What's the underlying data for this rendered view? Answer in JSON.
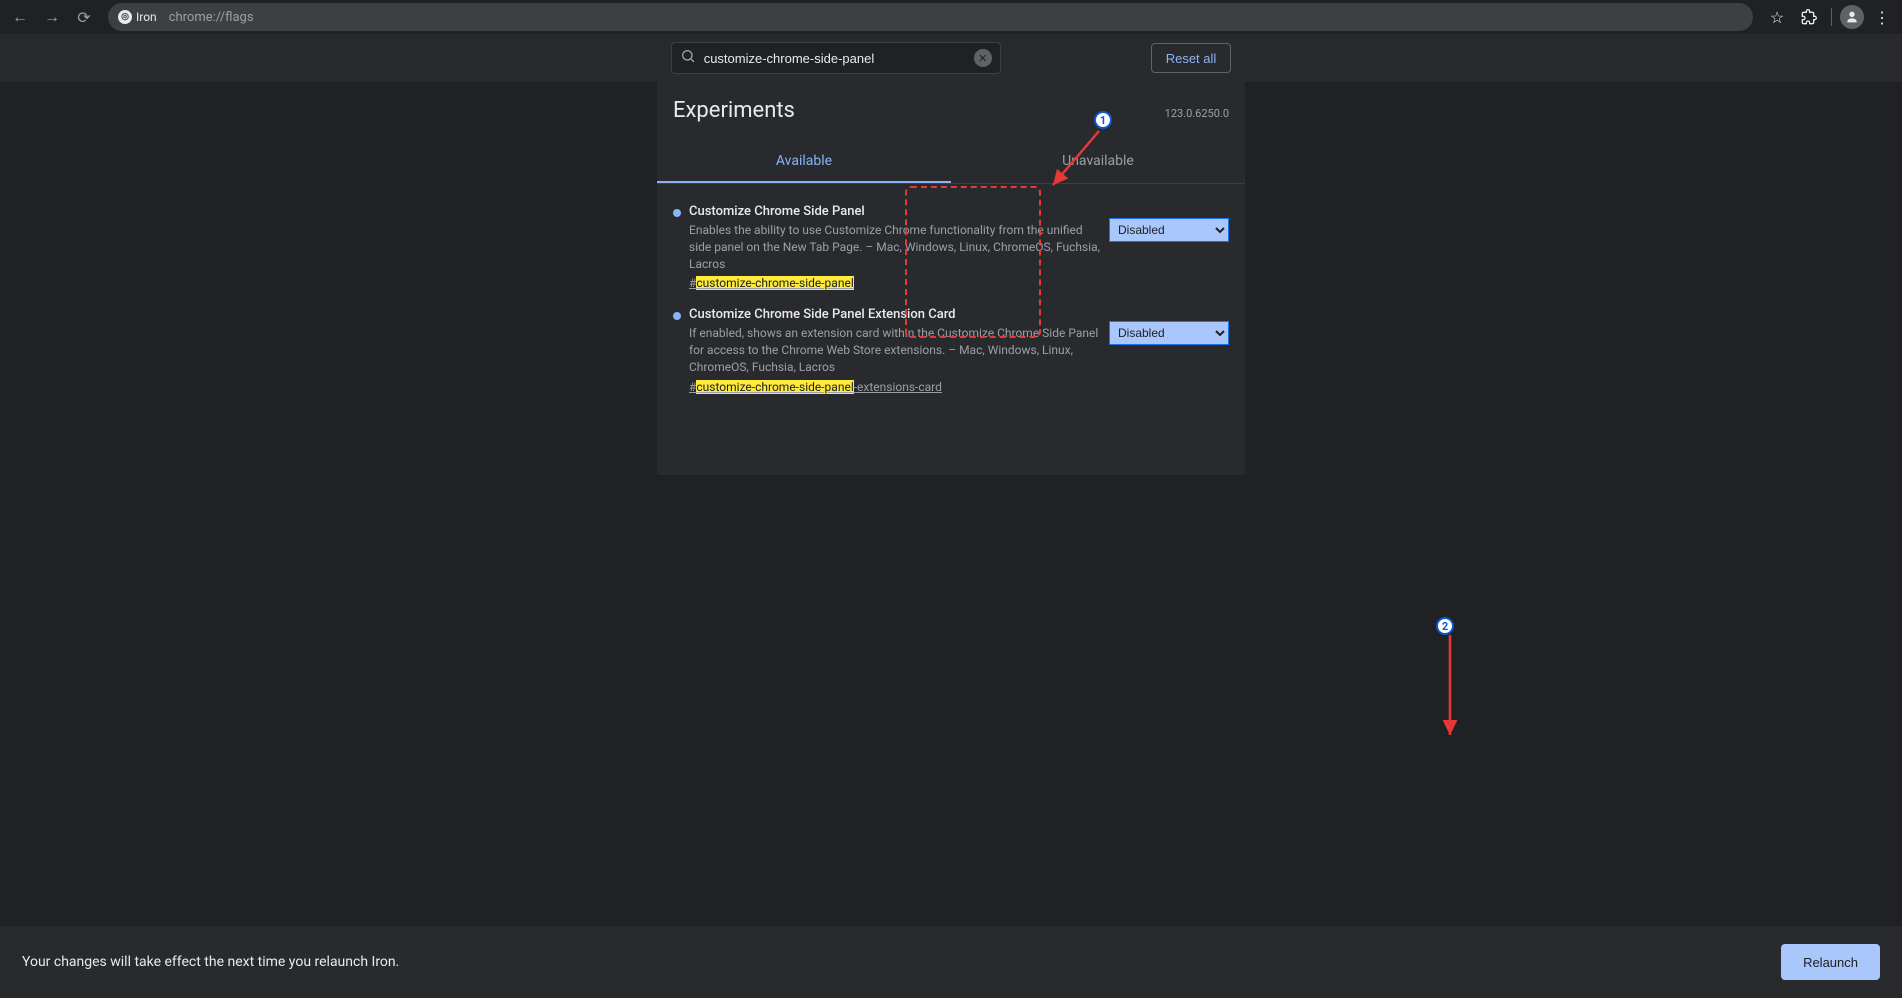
{
  "browser": {
    "back": "←",
    "forward": "→",
    "reload": "⟳",
    "site_name": "Iron",
    "url": "chrome://flags",
    "star": "☆",
    "ext": "",
    "menu": "⋮"
  },
  "header": {
    "search_value": "customize-chrome-side-panel",
    "reset_label": "Reset all"
  },
  "card": {
    "title": "Experiments",
    "version": "123.0.6250.0",
    "tab_available": "Available",
    "tab_unavailable": "Unavailable"
  },
  "flags": [
    {
      "title": "Customize Chrome Side Panel",
      "desc": "Enables the ability to use Customize Chrome functionality from the unified side panel on the New Tab Page. – Mac, Windows, Linux, ChromeOS, Fuchsia, Lacros",
      "hash_prefix": "#",
      "hash_hl": "customize-chrome-side-panel",
      "hash_suffix": "",
      "select": "Disabled"
    },
    {
      "title": "Customize Chrome Side Panel Extension Card",
      "desc": "If enabled, shows an extension card within the Customize Chrome Side Panel for access to the Chrome Web Store extensions. – Mac, Windows, Linux, ChromeOS, Fuchsia, Lacros",
      "hash_prefix": "#",
      "hash_hl": "customize-chrome-side-panel",
      "hash_suffix": "-extensions-card",
      "select": "Disabled"
    }
  ],
  "relaunch": {
    "msg": "Your changes will take effect the next time you relaunch Iron.",
    "btn": "Relaunch"
  },
  "annotations": {
    "one": "1",
    "two": "2"
  }
}
